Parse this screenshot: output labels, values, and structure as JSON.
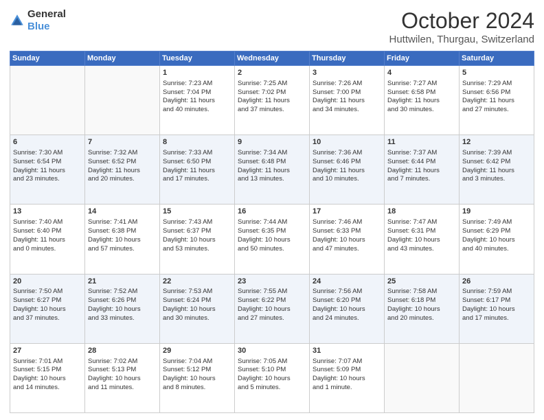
{
  "header": {
    "logo_general": "General",
    "logo_blue": "Blue",
    "month_title": "October 2024",
    "location": "Huttwilen, Thurgau, Switzerland"
  },
  "weekdays": [
    "Sunday",
    "Monday",
    "Tuesday",
    "Wednesday",
    "Thursday",
    "Friday",
    "Saturday"
  ],
  "rows": [
    [
      {
        "day": "",
        "lines": []
      },
      {
        "day": "",
        "lines": []
      },
      {
        "day": "1",
        "lines": [
          "Sunrise: 7:23 AM",
          "Sunset: 7:04 PM",
          "Daylight: 11 hours",
          "and 40 minutes."
        ]
      },
      {
        "day": "2",
        "lines": [
          "Sunrise: 7:25 AM",
          "Sunset: 7:02 PM",
          "Daylight: 11 hours",
          "and 37 minutes."
        ]
      },
      {
        "day": "3",
        "lines": [
          "Sunrise: 7:26 AM",
          "Sunset: 7:00 PM",
          "Daylight: 11 hours",
          "and 34 minutes."
        ]
      },
      {
        "day": "4",
        "lines": [
          "Sunrise: 7:27 AM",
          "Sunset: 6:58 PM",
          "Daylight: 11 hours",
          "and 30 minutes."
        ]
      },
      {
        "day": "5",
        "lines": [
          "Sunrise: 7:29 AM",
          "Sunset: 6:56 PM",
          "Daylight: 11 hours",
          "and 27 minutes."
        ]
      }
    ],
    [
      {
        "day": "6",
        "lines": [
          "Sunrise: 7:30 AM",
          "Sunset: 6:54 PM",
          "Daylight: 11 hours",
          "and 23 minutes."
        ]
      },
      {
        "day": "7",
        "lines": [
          "Sunrise: 7:32 AM",
          "Sunset: 6:52 PM",
          "Daylight: 11 hours",
          "and 20 minutes."
        ]
      },
      {
        "day": "8",
        "lines": [
          "Sunrise: 7:33 AM",
          "Sunset: 6:50 PM",
          "Daylight: 11 hours",
          "and 17 minutes."
        ]
      },
      {
        "day": "9",
        "lines": [
          "Sunrise: 7:34 AM",
          "Sunset: 6:48 PM",
          "Daylight: 11 hours",
          "and 13 minutes."
        ]
      },
      {
        "day": "10",
        "lines": [
          "Sunrise: 7:36 AM",
          "Sunset: 6:46 PM",
          "Daylight: 11 hours",
          "and 10 minutes."
        ]
      },
      {
        "day": "11",
        "lines": [
          "Sunrise: 7:37 AM",
          "Sunset: 6:44 PM",
          "Daylight: 11 hours",
          "and 7 minutes."
        ]
      },
      {
        "day": "12",
        "lines": [
          "Sunrise: 7:39 AM",
          "Sunset: 6:42 PM",
          "Daylight: 11 hours",
          "and 3 minutes."
        ]
      }
    ],
    [
      {
        "day": "13",
        "lines": [
          "Sunrise: 7:40 AM",
          "Sunset: 6:40 PM",
          "Daylight: 11 hours",
          "and 0 minutes."
        ]
      },
      {
        "day": "14",
        "lines": [
          "Sunrise: 7:41 AM",
          "Sunset: 6:38 PM",
          "Daylight: 10 hours",
          "and 57 minutes."
        ]
      },
      {
        "day": "15",
        "lines": [
          "Sunrise: 7:43 AM",
          "Sunset: 6:37 PM",
          "Daylight: 10 hours",
          "and 53 minutes."
        ]
      },
      {
        "day": "16",
        "lines": [
          "Sunrise: 7:44 AM",
          "Sunset: 6:35 PM",
          "Daylight: 10 hours",
          "and 50 minutes."
        ]
      },
      {
        "day": "17",
        "lines": [
          "Sunrise: 7:46 AM",
          "Sunset: 6:33 PM",
          "Daylight: 10 hours",
          "and 47 minutes."
        ]
      },
      {
        "day": "18",
        "lines": [
          "Sunrise: 7:47 AM",
          "Sunset: 6:31 PM",
          "Daylight: 10 hours",
          "and 43 minutes."
        ]
      },
      {
        "day": "19",
        "lines": [
          "Sunrise: 7:49 AM",
          "Sunset: 6:29 PM",
          "Daylight: 10 hours",
          "and 40 minutes."
        ]
      }
    ],
    [
      {
        "day": "20",
        "lines": [
          "Sunrise: 7:50 AM",
          "Sunset: 6:27 PM",
          "Daylight: 10 hours",
          "and 37 minutes."
        ]
      },
      {
        "day": "21",
        "lines": [
          "Sunrise: 7:52 AM",
          "Sunset: 6:26 PM",
          "Daylight: 10 hours",
          "and 33 minutes."
        ]
      },
      {
        "day": "22",
        "lines": [
          "Sunrise: 7:53 AM",
          "Sunset: 6:24 PM",
          "Daylight: 10 hours",
          "and 30 minutes."
        ]
      },
      {
        "day": "23",
        "lines": [
          "Sunrise: 7:55 AM",
          "Sunset: 6:22 PM",
          "Daylight: 10 hours",
          "and 27 minutes."
        ]
      },
      {
        "day": "24",
        "lines": [
          "Sunrise: 7:56 AM",
          "Sunset: 6:20 PM",
          "Daylight: 10 hours",
          "and 24 minutes."
        ]
      },
      {
        "day": "25",
        "lines": [
          "Sunrise: 7:58 AM",
          "Sunset: 6:18 PM",
          "Daylight: 10 hours",
          "and 20 minutes."
        ]
      },
      {
        "day": "26",
        "lines": [
          "Sunrise: 7:59 AM",
          "Sunset: 6:17 PM",
          "Daylight: 10 hours",
          "and 17 minutes."
        ]
      }
    ],
    [
      {
        "day": "27",
        "lines": [
          "Sunrise: 7:01 AM",
          "Sunset: 5:15 PM",
          "Daylight: 10 hours",
          "and 14 minutes."
        ]
      },
      {
        "day": "28",
        "lines": [
          "Sunrise: 7:02 AM",
          "Sunset: 5:13 PM",
          "Daylight: 10 hours",
          "and 11 minutes."
        ]
      },
      {
        "day": "29",
        "lines": [
          "Sunrise: 7:04 AM",
          "Sunset: 5:12 PM",
          "Daylight: 10 hours",
          "and 8 minutes."
        ]
      },
      {
        "day": "30",
        "lines": [
          "Sunrise: 7:05 AM",
          "Sunset: 5:10 PM",
          "Daylight: 10 hours",
          "and 5 minutes."
        ]
      },
      {
        "day": "31",
        "lines": [
          "Sunrise: 7:07 AM",
          "Sunset: 5:09 PM",
          "Daylight: 10 hours",
          "and 1 minute."
        ]
      },
      {
        "day": "",
        "lines": []
      },
      {
        "day": "",
        "lines": []
      }
    ]
  ]
}
